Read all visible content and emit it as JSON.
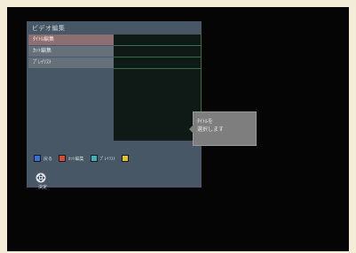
{
  "panel": {
    "title": "ビデオ編集",
    "menu_items": [
      {
        "label": "ﾀｲﾄﾙ編集"
      },
      {
        "label": "ｶｯﾄ編集"
      },
      {
        "label": "ﾌﾟﾚｲﾘｽﾄ"
      }
    ],
    "selected_index": 0
  },
  "tooltip": {
    "lines": [
      "ﾀｲﾄﾙを",
      "選択します"
    ]
  },
  "legend": [
    {
      "key": "blue",
      "color": "#3a6fd8",
      "label": "戻る"
    },
    {
      "key": "red",
      "color": "#d84a34",
      "label": "ｶｯﾄ編集"
    },
    {
      "key": "cyan",
      "color": "#3fb3b8",
      "label": "ﾌﾟﾚｲﾘｽﾄ"
    },
    {
      "key": "yellow",
      "color": "#e0c23a",
      "label": ""
    }
  ],
  "footer": {
    "select_label": "決定"
  },
  "colors": {
    "panel": "#475765",
    "list_box": "#0f1a16",
    "selected_item": "#8b6f72"
  }
}
